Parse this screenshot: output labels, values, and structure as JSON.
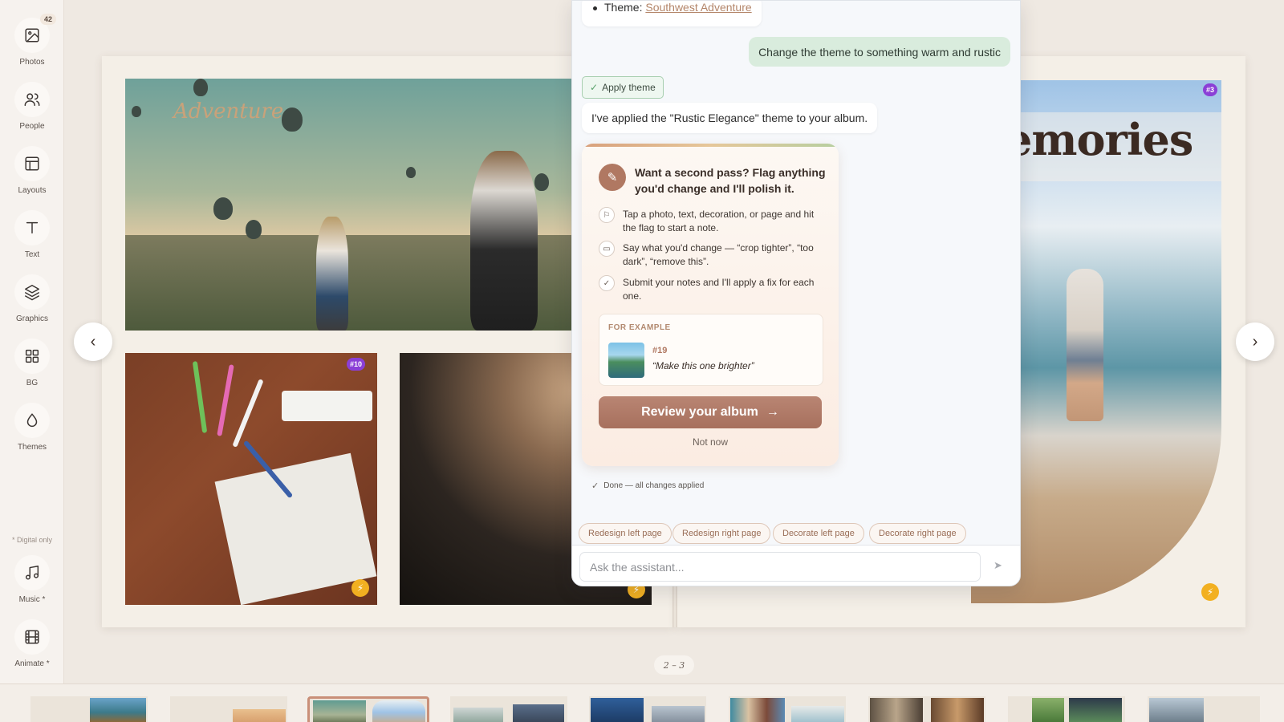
{
  "toolbar": {
    "items": [
      {
        "label": "Photos",
        "icon": "image-icon",
        "badge": "42"
      },
      {
        "label": "People",
        "icon": "users-icon"
      },
      {
        "label": "Layouts",
        "icon": "layout-icon"
      },
      {
        "label": "Text",
        "icon": "text-icon"
      },
      {
        "label": "Graphics",
        "icon": "layers-icon"
      },
      {
        "label": "BG",
        "icon": "grid-icon"
      },
      {
        "label": "Themes",
        "icon": "drop-icon"
      },
      {
        "label": "Music *",
        "icon": "music-icon"
      },
      {
        "label": "Animate *",
        "icon": "film-icon"
      }
    ],
    "digital_note": "* Digital only"
  },
  "canvas": {
    "left_page_text": "Adventure",
    "right_page_text": "emories",
    "badges": {
      "art": "#10",
      "beach": "#3"
    },
    "spread_indicator": "2 – 3"
  },
  "chat": {
    "theme_msg": {
      "prefix": "Theme: ",
      "link": "Southwest Adventure"
    },
    "user_msg": "Change the theme to something warm and rustic",
    "apply_chip": "Apply theme",
    "bot_msg": "I've applied the \"Rustic Elegance\" theme to your album.",
    "card": {
      "title": "Want a second pass? Flag anything you'd change and I'll polish it.",
      "steps": [
        "Tap a photo, text, decoration, or page and hit the flag to start a note.",
        "Say what you'd change — “crop tighter”, “too dark”, “remove this”.",
        "Submit your notes and I'll apply a fix for each one."
      ],
      "example_label": "FOR EXAMPLE",
      "example_num": "#19",
      "example_quote": "“Make this one brighter”",
      "review_button": "Review your album",
      "not_now": "Not now"
    },
    "done_text": "Done — all changes applied",
    "quick_actions": [
      "Redesign left page",
      "Redesign right page",
      "Decorate left page",
      "Decorate right page"
    ],
    "input_placeholder": "Ask the assistant..."
  },
  "colors": {
    "accent": "#b07862",
    "success": "#58a16a",
    "badge": "#8b3fd6",
    "bolt": "#f2b021"
  }
}
